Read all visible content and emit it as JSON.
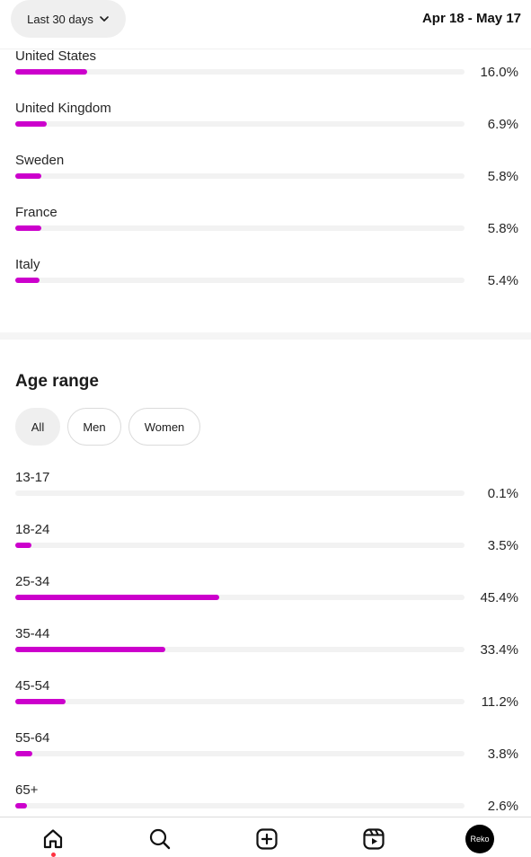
{
  "header": {
    "date_filter_label": "Last 30 days",
    "date_range": "Apr 18 - May 17"
  },
  "colors": {
    "bar_fill": "#cc00cc",
    "bar_track": "#f2f2f2"
  },
  "countries": [
    {
      "label": "United States",
      "value": "16.0%",
      "fraction": 0.16
    },
    {
      "label": "United Kingdom",
      "value": "6.9%",
      "fraction": 0.069
    },
    {
      "label": "Sweden",
      "value": "5.8%",
      "fraction": 0.058
    },
    {
      "label": "France",
      "value": "5.8%",
      "fraction": 0.058
    },
    {
      "label": "Italy",
      "value": "5.4%",
      "fraction": 0.054
    }
  ],
  "age_section": {
    "title": "Age range",
    "filters": [
      "All",
      "Men",
      "Women"
    ],
    "selected_filter": "All",
    "rows": [
      {
        "label": "13-17",
        "value": "0.1%",
        "fraction": 0.001
      },
      {
        "label": "18-24",
        "value": "3.5%",
        "fraction": 0.035
      },
      {
        "label": "25-34",
        "value": "45.4%",
        "fraction": 0.454
      },
      {
        "label": "35-44",
        "value": "33.4%",
        "fraction": 0.334
      },
      {
        "label": "45-54",
        "value": "11.2%",
        "fraction": 0.112
      },
      {
        "label": "55-64",
        "value": "3.8%",
        "fraction": 0.038
      },
      {
        "label": "65+",
        "value": "2.6%",
        "fraction": 0.026
      }
    ]
  },
  "bottom_nav": {
    "items": [
      "home-icon",
      "search-icon",
      "create-icon",
      "reels-icon",
      "profile-avatar"
    ],
    "avatar_text": "Reko"
  }
}
